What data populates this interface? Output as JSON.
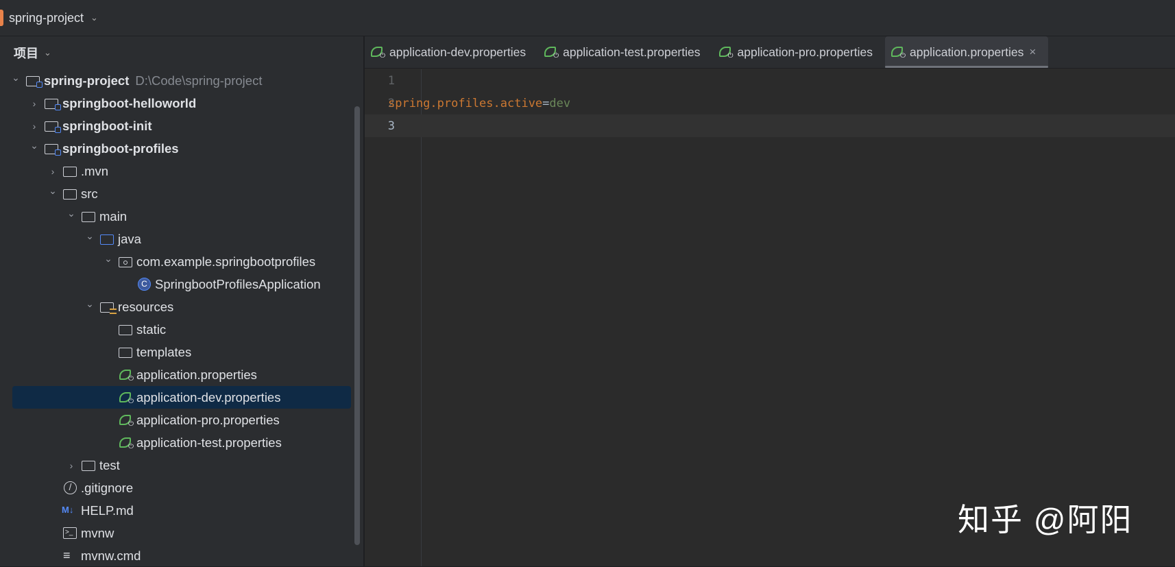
{
  "topbar": {
    "project": "spring-project"
  },
  "sidebar": {
    "title": "项目",
    "tree": [
      {
        "label": "spring-project",
        "path": "D:\\Code\\spring-project",
        "level": 0,
        "expanded": true,
        "icon": "module-folder-icon",
        "bold": true
      },
      {
        "label": "springboot-helloworld",
        "level": 1,
        "expanded": false,
        "icon": "module-folder-icon",
        "bold": true
      },
      {
        "label": "springboot-init",
        "level": 1,
        "expanded": false,
        "icon": "module-folder-icon",
        "bold": true
      },
      {
        "label": "springboot-profiles",
        "level": 1,
        "expanded": true,
        "icon": "module-folder-icon",
        "bold": true
      },
      {
        "label": ".mvn",
        "level": 2,
        "expanded": false,
        "icon": "folder-icon"
      },
      {
        "label": "src",
        "level": 2,
        "expanded": true,
        "icon": "folder-icon"
      },
      {
        "label": "main",
        "level": 3,
        "expanded": true,
        "icon": "folder-icon"
      },
      {
        "label": "java",
        "level": 4,
        "expanded": true,
        "icon": "source-folder-icon"
      },
      {
        "label": "com.example.springbootprofiles",
        "level": 5,
        "expanded": true,
        "icon": "package-icon"
      },
      {
        "label": "SpringbootProfilesApplication",
        "level": 6,
        "icon": "spring-class-icon"
      },
      {
        "label": "resources",
        "level": 4,
        "expanded": true,
        "icon": "resources-folder-icon"
      },
      {
        "label": "static",
        "level": 5,
        "icon": "folder-icon"
      },
      {
        "label": "templates",
        "level": 5,
        "icon": "folder-icon"
      },
      {
        "label": "application.properties",
        "level": 5,
        "icon": "spring-properties-icon"
      },
      {
        "label": "application-dev.properties",
        "level": 5,
        "icon": "spring-properties-icon",
        "selected": true
      },
      {
        "label": "application-pro.properties",
        "level": 5,
        "icon": "spring-properties-icon"
      },
      {
        "label": "application-test.properties",
        "level": 5,
        "icon": "spring-properties-icon"
      },
      {
        "label": "test",
        "level": 3,
        "expanded": false,
        "icon": "folder-icon"
      },
      {
        "label": ".gitignore",
        "level": 2,
        "icon": "ignore-file-icon"
      },
      {
        "label": "HELP.md",
        "level": 2,
        "icon": "markdown-icon"
      },
      {
        "label": "mvnw",
        "level": 2,
        "icon": "terminal-file-icon"
      },
      {
        "label": "mvnw.cmd",
        "level": 2,
        "icon": "text-file-icon"
      }
    ]
  },
  "tabs": [
    {
      "label": "application-dev.properties"
    },
    {
      "label": "application-test.properties"
    },
    {
      "label": "application-pro.properties"
    },
    {
      "label": "application.properties",
      "active": true,
      "close": "×"
    }
  ],
  "editor": {
    "lines": [
      "1",
      "2",
      "3"
    ],
    "current_line": 3,
    "code": {
      "key": "spring.profiles.active",
      "eq": "=",
      "value": "dev"
    }
  },
  "watermark": "知乎 @阿阳"
}
